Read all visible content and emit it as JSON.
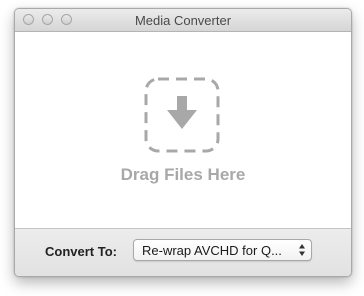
{
  "window": {
    "title": "Media Converter"
  },
  "dropzone": {
    "label": "Drag Files Here",
    "icon": "down-arrow-icon"
  },
  "convert": {
    "label": "Convert To:",
    "selected": "Re-wrap AVCHD for Q..."
  },
  "colors": {
    "drop_icon": "#a8a8a8",
    "drop_label": "#a8a8a8"
  }
}
